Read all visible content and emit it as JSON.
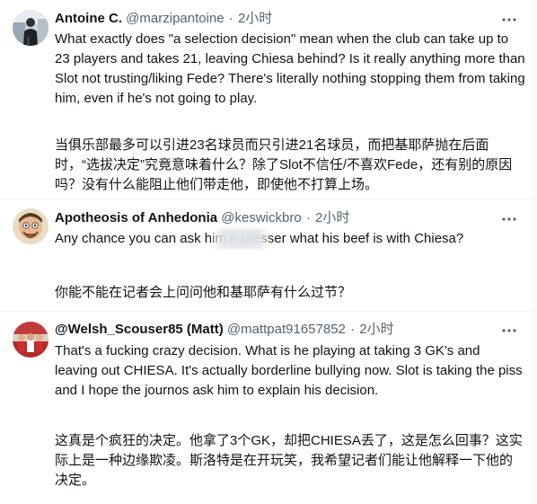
{
  "tweets": [
    {
      "display_name": "Antoine C.",
      "handle": "@marzipantoine",
      "separator": "·",
      "time": "2小时",
      "text_en": "What exactly does \"a selection decision\" mean when the club can take up to 23 players and takes 21, leaving Chiesa behind? Is it really anything more than Slot not trusting/liking Fede? There's literally nothing stopping them from taking him, even if he's not going to play.",
      "text_zh": "当俱乐部最多可以引进23名球员而只引进21名球员，而把基耶萨抛在后面时，“选拔决定”究竟意味着什么？除了Slot不信任/不喜欢Fede，还有别的原因吗？没有什么能阻止他们带走他，即使他不打算上场。",
      "avatar_icon": "person-photo-avatar",
      "more_icon": "more-options-icon"
    },
    {
      "display_name": "Apotheosis of Anhedonia",
      "handle": "@keswickbro",
      "separator": "·",
      "time": "2小时",
      "text_en": "Any chance you can ask him        e presser what his beef is with Chiesa?",
      "text_zh": "你能不能在记者会上问问他和基耶萨有什么过节？",
      "avatar_icon": "cartoon-face-avatar",
      "more_icon": "more-options-icon"
    },
    {
      "display_name": "@Welsh_Scouser85 (Matt)",
      "handle": "@mattpat91657852",
      "separator": "·",
      "time": "2小时",
      "text_en": "That's a fucking crazy decision. What is he playing at taking 3 GK's and leaving out CHIESA. It's actually borderline bullying now. Slot is taking the piss and I hope the journos ask him to explain his decision.",
      "text_zh": "这真是个疯狂的决定。他拿了3个GK，却把CHIESA丢了，这是怎么回事？这实际上是一种边缘欺凌。斯洛特是在开玩笑，我希望记者们能让他解释一下他的决定。",
      "avatar_icon": "red-crowd-avatar",
      "more_icon": "more-options-icon"
    }
  ],
  "colors": {
    "text_primary": "#0f1419",
    "text_secondary": "#536471",
    "divider": "#eff3f4"
  }
}
